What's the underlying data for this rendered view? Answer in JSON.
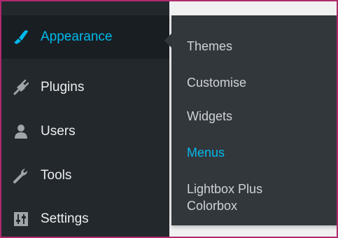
{
  "sidebar": {
    "items": [
      {
        "label": "Appearance",
        "icon": "paint-brush-icon",
        "current": true
      },
      {
        "label": "Plugins",
        "icon": "plug-icon"
      },
      {
        "label": "Users",
        "icon": "user-icon"
      },
      {
        "label": "Tools",
        "icon": "wrench-icon"
      },
      {
        "label": "Settings",
        "icon": "sliders-icon"
      }
    ]
  },
  "flyout": {
    "items": [
      {
        "label": "Themes"
      },
      {
        "label": "Customise"
      },
      {
        "label": "Widgets"
      },
      {
        "label": "Menus",
        "active": true
      },
      {
        "label_line1": "Lightbox Plus",
        "label_line2": "Colorbox"
      }
    ]
  },
  "colors": {
    "sidebar_bg": "#23282d",
    "flyout_bg": "#32373c",
    "accent": "#00b9eb",
    "frame_border": "#b0296e"
  }
}
